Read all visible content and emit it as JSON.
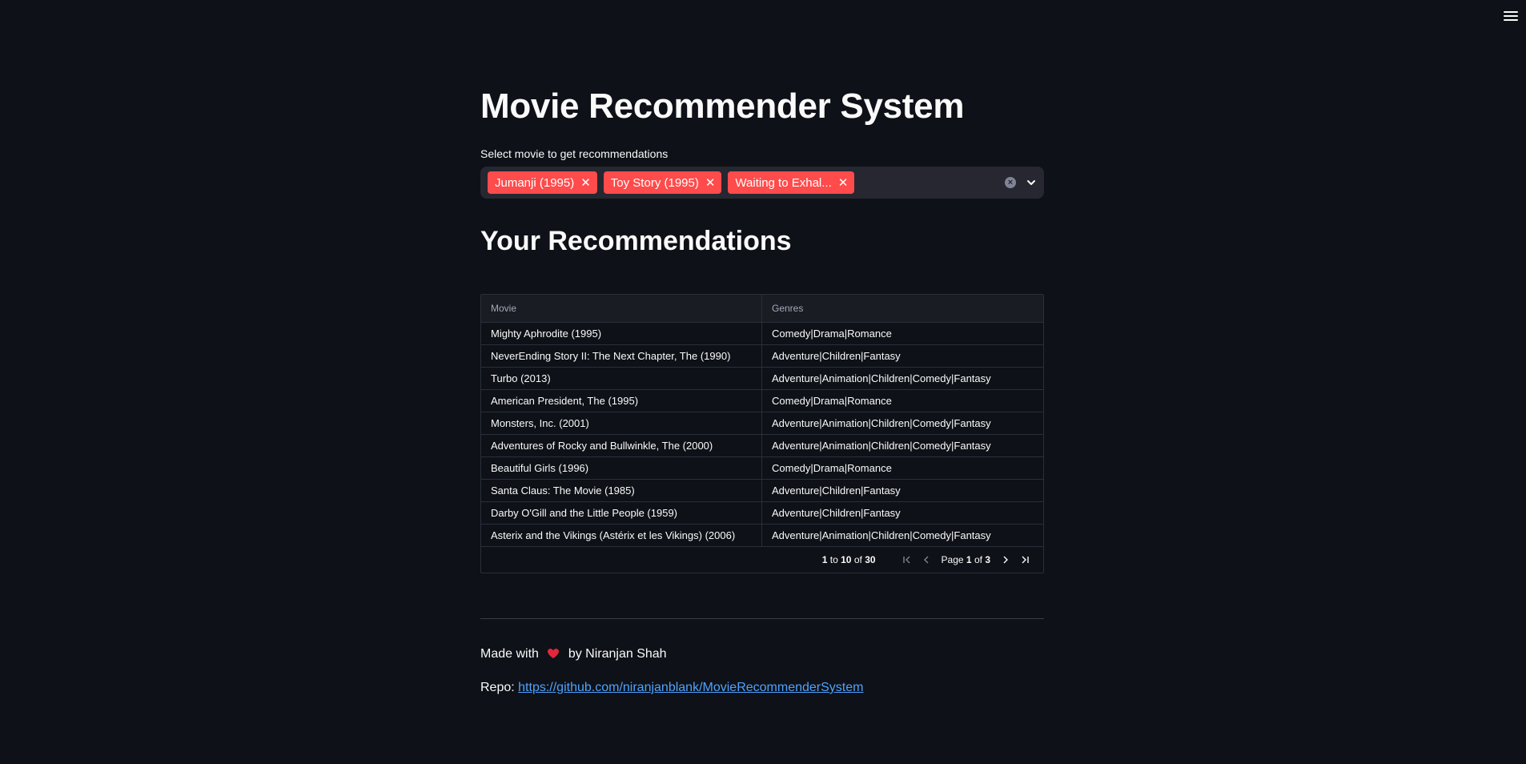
{
  "app": {
    "menu_icon": "hamburger-menu-icon"
  },
  "header": {
    "title": "Movie Recommender System"
  },
  "selector": {
    "label": "Select movie to get recommendations",
    "chips": [
      {
        "label": "Jumanji (1995)"
      },
      {
        "label": "Toy Story (1995)"
      },
      {
        "label": "Waiting to Exhal..."
      }
    ],
    "chip_color": "#ff4b4b"
  },
  "recommendations": {
    "heading": "Your Recommendations",
    "columns": [
      "Movie",
      "Genres"
    ],
    "rows": [
      [
        "Mighty Aphrodite (1995)",
        "Comedy|Drama|Romance"
      ],
      [
        "NeverEnding Story II: The Next Chapter, The (1990)",
        "Adventure|Children|Fantasy"
      ],
      [
        "Turbo (2013)",
        "Adventure|Animation|Children|Comedy|Fantasy"
      ],
      [
        "American President, The (1995)",
        "Comedy|Drama|Romance"
      ],
      [
        "Monsters, Inc. (2001)",
        "Adventure|Animation|Children|Comedy|Fantasy"
      ],
      [
        "Adventures of Rocky and Bullwinkle, The (2000)",
        "Adventure|Animation|Children|Comedy|Fantasy"
      ],
      [
        "Beautiful Girls (1996)",
        "Comedy|Drama|Romance"
      ],
      [
        "Santa Claus: The Movie (1985)",
        "Adventure|Children|Fantasy"
      ],
      [
        "Darby O'Gill and the Little People (1959)",
        "Adventure|Children|Fantasy"
      ],
      [
        "Asterix and the Vikings (Astérix et les Vikings) (2006)",
        "Adventure|Animation|Children|Comedy|Fantasy"
      ]
    ],
    "pager": {
      "from": "1",
      "to_word": "to",
      "to": "10",
      "of_word": "of",
      "total": "30",
      "page_word": "Page",
      "page": "1",
      "page_of_word": "of",
      "pages": "3"
    }
  },
  "footer": {
    "made_with": "Made with",
    "by": "by Niranjan Shah",
    "repo_label": "Repo:",
    "repo_url": "https://github.com/niranjanblank/MovieRecommenderSystem"
  }
}
